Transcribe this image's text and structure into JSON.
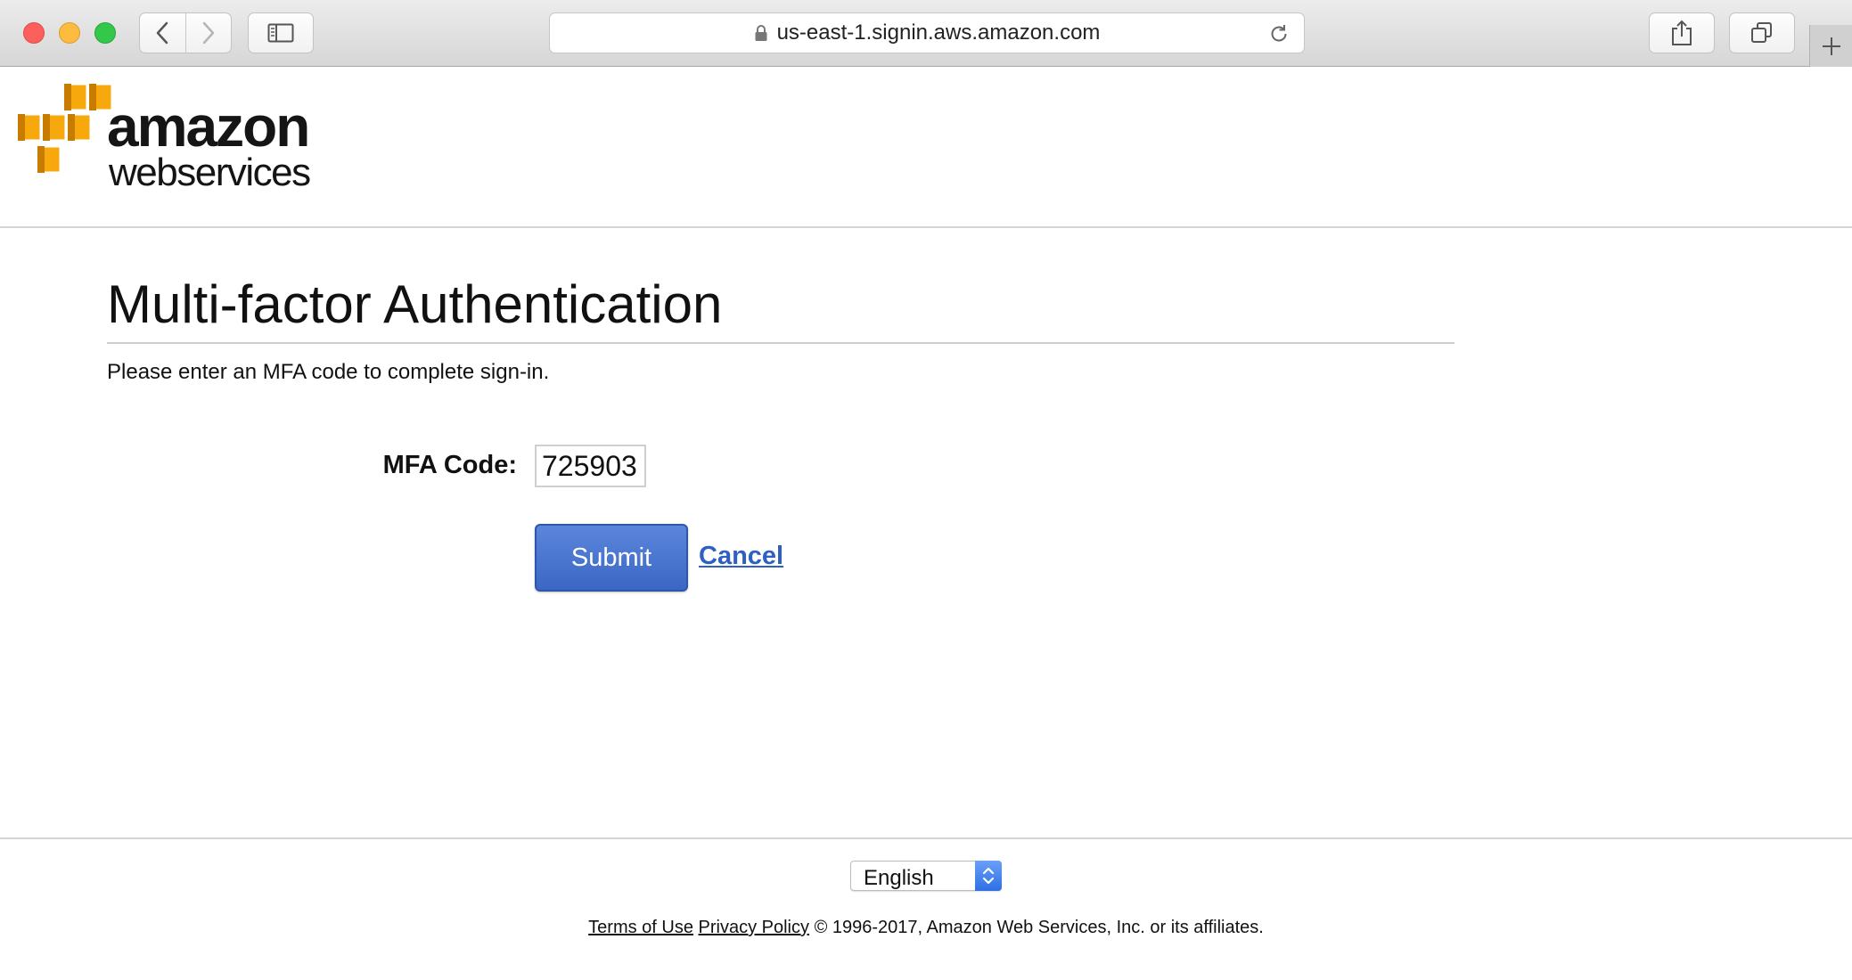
{
  "browser": {
    "url": "us-east-1.signin.aws.amazon.com"
  },
  "logo": {
    "line1": "amazon",
    "line2": "webservices",
    "brand_color": "#f7a80d"
  },
  "page": {
    "title": "Multi-factor Authentication",
    "subtitle": "Please enter an MFA code to complete sign-in."
  },
  "form": {
    "mfa_label": "MFA Code:",
    "mfa_value": "725903",
    "submit_label": "Submit",
    "cancel_label": "Cancel",
    "submit_color": "#3f6bcb",
    "link_color": "#2f5fc3"
  },
  "footer": {
    "language": "English",
    "terms_label": "Terms of Use",
    "privacy_label": "Privacy Policy",
    "copyright": "© 1996-2017, Amazon Web Services, Inc. or its affiliates."
  }
}
